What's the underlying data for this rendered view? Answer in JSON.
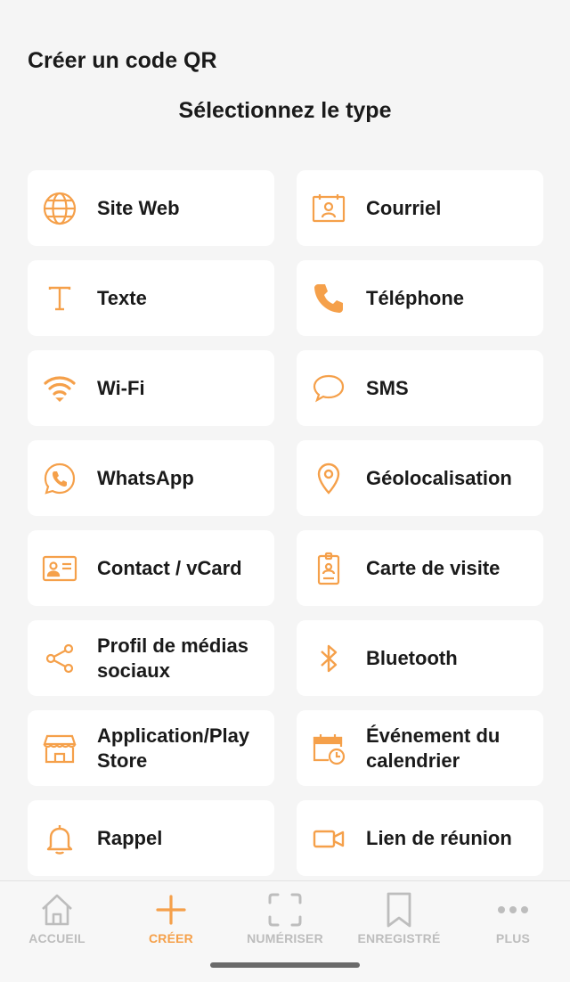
{
  "header": {
    "app_title": "Créer un code QR",
    "section_title": "Sélectionnez le type"
  },
  "accent_color": "#f5a04a",
  "inactive_color": "#bdbdbd",
  "types": [
    {
      "label": "Site Web",
      "icon": "globe-icon"
    },
    {
      "label": "Courriel",
      "icon": "email-icon"
    },
    {
      "label": "Texte",
      "icon": "text-icon"
    },
    {
      "label": "Téléphone",
      "icon": "phone-icon"
    },
    {
      "label": "Wi-Fi",
      "icon": "wifi-icon"
    },
    {
      "label": "SMS",
      "icon": "sms-icon"
    },
    {
      "label": "WhatsApp",
      "icon": "whatsapp-icon"
    },
    {
      "label": "Géolocalisation",
      "icon": "location-pin-icon"
    },
    {
      "label": "Contact / vCard",
      "icon": "contact-card-icon"
    },
    {
      "label": "Carte de visite",
      "icon": "badge-icon"
    },
    {
      "label": "Profil de médias sociaux",
      "icon": "share-icon"
    },
    {
      "label": "Bluetooth",
      "icon": "bluetooth-icon"
    },
    {
      "label": "Application/Play Store",
      "icon": "store-icon"
    },
    {
      "label": "Événement du calendrier",
      "icon": "calendar-icon"
    },
    {
      "label": "Rappel",
      "icon": "bell-icon"
    },
    {
      "label": "Lien de réunion",
      "icon": "video-camera-icon"
    }
  ],
  "nav": {
    "items": [
      {
        "label": "ACCUEIL",
        "icon": "home-icon",
        "active": false
      },
      {
        "label": "CRÉER",
        "icon": "plus-icon",
        "active": true
      },
      {
        "label": "NUMÉRISER",
        "icon": "scan-icon",
        "active": false
      },
      {
        "label": "ENREGISTRÉ",
        "icon": "bookmark-icon",
        "active": false
      },
      {
        "label": "PLUS",
        "icon": "more-icon",
        "active": false
      }
    ]
  }
}
